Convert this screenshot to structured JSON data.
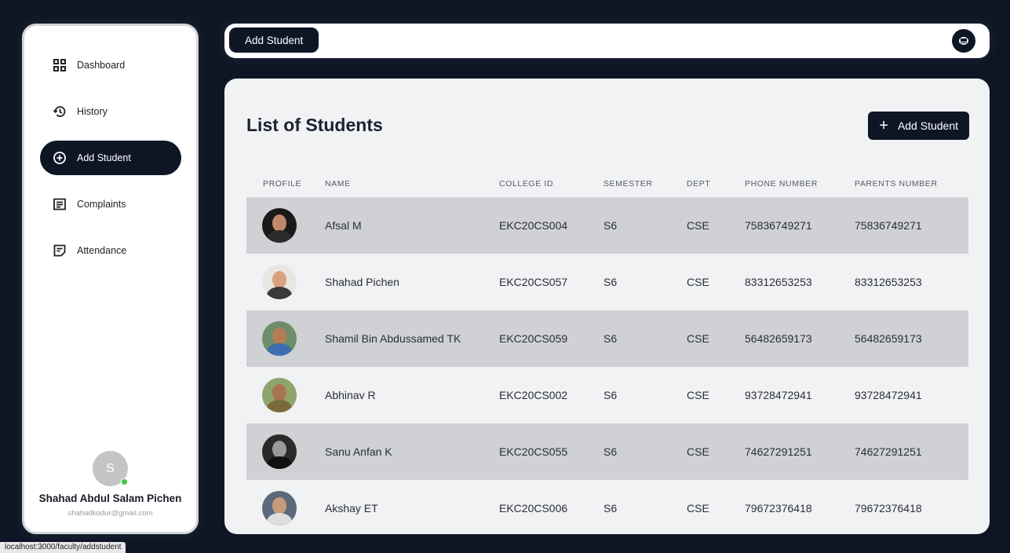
{
  "sidebar": {
    "items": [
      {
        "label": "Dashboard",
        "icon": "dashboard-icon",
        "active": false
      },
      {
        "label": "History",
        "icon": "history-icon",
        "active": false
      },
      {
        "label": "Add Student",
        "icon": "add-circle-icon",
        "active": true
      },
      {
        "label": "Complaints",
        "icon": "complaints-icon",
        "active": false
      },
      {
        "label": "Attendance",
        "icon": "attendance-icon",
        "active": false
      }
    ],
    "profile": {
      "initial": "S",
      "name": "Shahad Abdul Salam Pichen",
      "email": "shahadkodur@gmail.com",
      "status_color": "#3ec73e"
    }
  },
  "topbar": {
    "title": "Add Student",
    "menu_icon": "menu-icon"
  },
  "main": {
    "title": "List of Students",
    "add_button_label": "Add Student",
    "columns": [
      "PROFILE",
      "NAME",
      "COLLEGE ID",
      "SEMESTER",
      "DEPT",
      "PHONE NUMBER",
      "PARENTS NUMBER"
    ],
    "rows": [
      {
        "name": "Afsal M",
        "college_id": "EKC20CS004",
        "semester": "S6",
        "dept": "CSE",
        "phone": "75836749271",
        "parents": "75836749271"
      },
      {
        "name": "Shahad Pichen",
        "college_id": "EKC20CS057",
        "semester": "S6",
        "dept": "CSE",
        "phone": "83312653253",
        "parents": "83312653253"
      },
      {
        "name": "Shamil Bin Abdussamed TK",
        "college_id": "EKC20CS059",
        "semester": "S6",
        "dept": "CSE",
        "phone": "56482659173",
        "parents": "56482659173"
      },
      {
        "name": "Abhinav R",
        "college_id": "EKC20CS002",
        "semester": "S6",
        "dept": "CSE",
        "phone": "93728472941",
        "parents": "93728472941"
      },
      {
        "name": "Sanu Anfan K",
        "college_id": "EKC20CS055",
        "semester": "S6",
        "dept": "CSE",
        "phone": "74627291251",
        "parents": "74627291251"
      },
      {
        "name": "Akshay ET",
        "college_id": "EKC20CS006",
        "semester": "S6",
        "dept": "CSE",
        "phone": "79672376418",
        "parents": "79672376418"
      }
    ]
  },
  "colors": {
    "background": "#0e1626",
    "accent": "#0e1626",
    "panel": "#f1f2f4",
    "row_shade": "#cfd1d4"
  },
  "statusbar": {
    "url": "localhost:3000/faculty/addstudent"
  }
}
